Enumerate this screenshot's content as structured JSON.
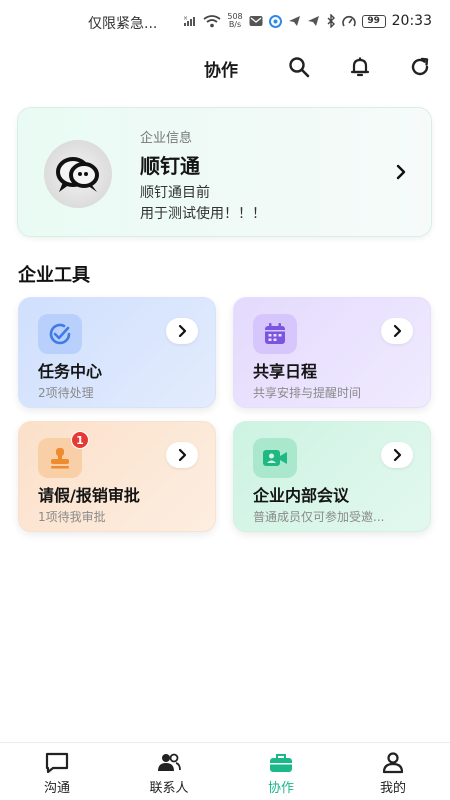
{
  "status_bar": {
    "carrier_text": "仅限紧急...",
    "net_speed_value": "508",
    "net_speed_unit": "B/s",
    "battery": "99",
    "time": "20:33"
  },
  "header": {
    "title": "协作"
  },
  "enterprise_card": {
    "label": "企业信息",
    "name": "顺钉通",
    "description_line1": "顺钉通目前",
    "description_line2": "用于测试使用！！！"
  },
  "section": {
    "title": "企业工具"
  },
  "tools": [
    {
      "title": "任务中心",
      "subtitle": "2项待处理",
      "icon": "check-circle-icon",
      "color": "#3f7be8"
    },
    {
      "title": "共享日程",
      "subtitle": "共享安排与提醒时间",
      "icon": "calendar-icon",
      "color": "#7b55e0"
    },
    {
      "title": "请假/报销审批",
      "subtitle": "1项待我审批",
      "icon": "stamp-icon",
      "color": "#ef8a2e",
      "badge": "1"
    },
    {
      "title": "企业内部会议",
      "subtitle": "普通成员仅可参加受邀...",
      "icon": "video-camera-icon",
      "color": "#1fb883"
    }
  ],
  "bottom_nav": {
    "items": [
      {
        "label": "沟通",
        "icon": "chat-icon"
      },
      {
        "label": "联系人",
        "icon": "contacts-icon"
      },
      {
        "label": "协作",
        "icon": "briefcase-icon",
        "active": true
      },
      {
        "label": "我的",
        "icon": "person-icon"
      }
    ]
  },
  "colors": {
    "accent": "#1bb88a",
    "badge": "#e53935"
  }
}
